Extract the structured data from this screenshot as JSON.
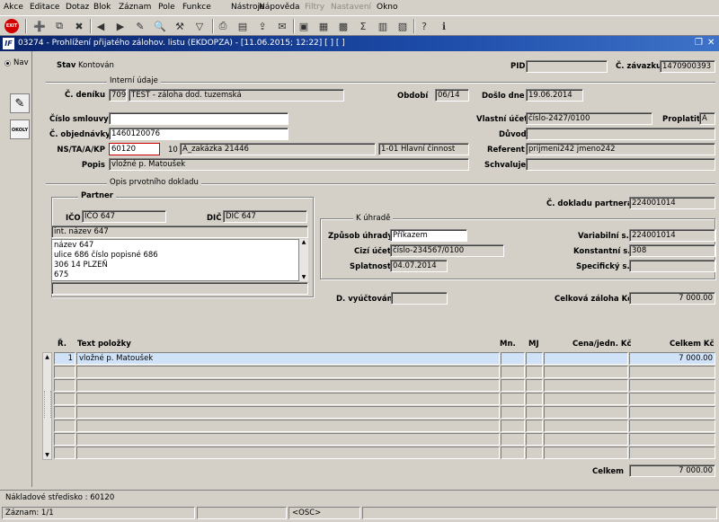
{
  "menu": [
    "Akce",
    "Editace",
    "Dotaz",
    "Blok",
    "Záznam",
    "Pole",
    "Funkce",
    "Nástroje",
    "Nápověda",
    "Filtry",
    "Nastavení",
    "Okno"
  ],
  "toolbar": {
    "exit_label": "EXIT",
    "icons": [
      "insert-record-icon",
      "duplicate-record-icon",
      "delete-record-icon",
      "previous-icon",
      "next-icon",
      "edit-icon",
      "search-icon",
      "tools-icon",
      "filter-icon",
      "print-icon",
      "print-preview-icon",
      "export-icon",
      "mail-icon",
      "notes-icon",
      "calendar-icon",
      "calculator-icon",
      "sigma-icon",
      "table-icon",
      "chart-icon",
      "help-icon",
      "info-icon"
    ]
  },
  "window": {
    "title": "03274 - Prohlížení přijatého zálohov. listu (EKDOPZA) - [11.06.2015; 12:22] [ ] [ ]",
    "logo": "IF",
    "restore_glyph": "❐",
    "close_glyph": "✕"
  },
  "side": {
    "nav_label": "Nav",
    "okoly_label": "OKOLY"
  },
  "header": {
    "stav_label": "Stav",
    "stav_value": "Kontován",
    "pid_label": "PID",
    "pid_value": "",
    "zavazku_label": "Č. závazku",
    "zavazku_value": "1470900393"
  },
  "interni": {
    "section_title": "Interní údaje",
    "denik_label": "Č. deníku",
    "denik_value": "709",
    "denik_name": "TEST - záloha dod. tuzemská",
    "obdobi_label": "Období",
    "obdobi_value": "06/14",
    "doslo_label": "Došlo dne",
    "doslo_value": "19.06.2014",
    "smlouvy_label": "Číslo smlouvy",
    "smlouvy_value": "",
    "vlastni_label": "Vlastní účet",
    "vlastni_value": "číslo-2427/0100",
    "proplatit_label": "Proplatit",
    "proplatit_value": "A",
    "objednavky_label": "Č. objednávky",
    "objednavky_value": "1460120076",
    "duvod_label": "Důvod",
    "duvod_value": "",
    "ns_label": "NS/TA/A/KP",
    "ns_value": "60120",
    "ta_value": "10",
    "a_value": "A_zakázka 21446",
    "kp_value": "1-01 Hlavní činnost",
    "referent_label": "Referent",
    "referent_value": "prijmeni242 jmeno242",
    "popis_label": "Popis",
    "popis_value": "vložné p. Matoušek",
    "schvaluje_label": "Schvaluje",
    "schvaluje_value": ""
  },
  "opis": {
    "section_title": "Opis prvotního dokladu",
    "partner_title": "Partner",
    "ico_label": "IČO",
    "ico_value": "IČO 647",
    "dic_label": "DIČ",
    "dic_value": "DIČ 647",
    "int_nazev": "int. název 647",
    "address_lines": [
      "název 647",
      "ulice 686 číslo popisné 686",
      "306 14 PLZEŇ",
      "675"
    ],
    "extra_line": "",
    "doklad_label": "Č. dokladu partnera",
    "doklad_value": "224001014"
  },
  "k_uhrade": {
    "title": "K úhradě",
    "zpusob_label": "Způsob úhrady",
    "zpusob_value": "Příkazem",
    "cizi_label": "Cizí účet",
    "cizi_value": "číslo-234567/0100",
    "splatnost_label": "Splatnost",
    "splatnost_value": "04.07.2014",
    "variabilni_label": "Variabilní s.",
    "variabilni_value": "224001014",
    "konstantni_label": "Konstantní s.",
    "konstantni_value": "308",
    "specificky_label": "Specifický s.",
    "specificky_value": ""
  },
  "totals": {
    "vyuctovani_label": "D. vyúčtování",
    "vyuctovani_value": "",
    "celkova_label": "Celková záloha Kč",
    "celkova_value": "7 000.00"
  },
  "items": {
    "headers": {
      "r": "Ř.",
      "text": "Text položky",
      "mn": "Mn.",
      "mj": "MJ",
      "cena": "Cena/jedn. Kč",
      "celkem": "Celkem Kč"
    },
    "rows": [
      {
        "r": "1",
        "text": "vložné p. Matoušek",
        "mn": "",
        "mj": "",
        "cena": "",
        "celkem": "7 000.00"
      }
    ],
    "celkem_label": "Celkem",
    "celkem_value": "7 000.00"
  },
  "status": {
    "nakladove": "Nákladové středisko : 60120",
    "zaznam": "Záznam: 1/1",
    "osc": "<OSC>"
  }
}
